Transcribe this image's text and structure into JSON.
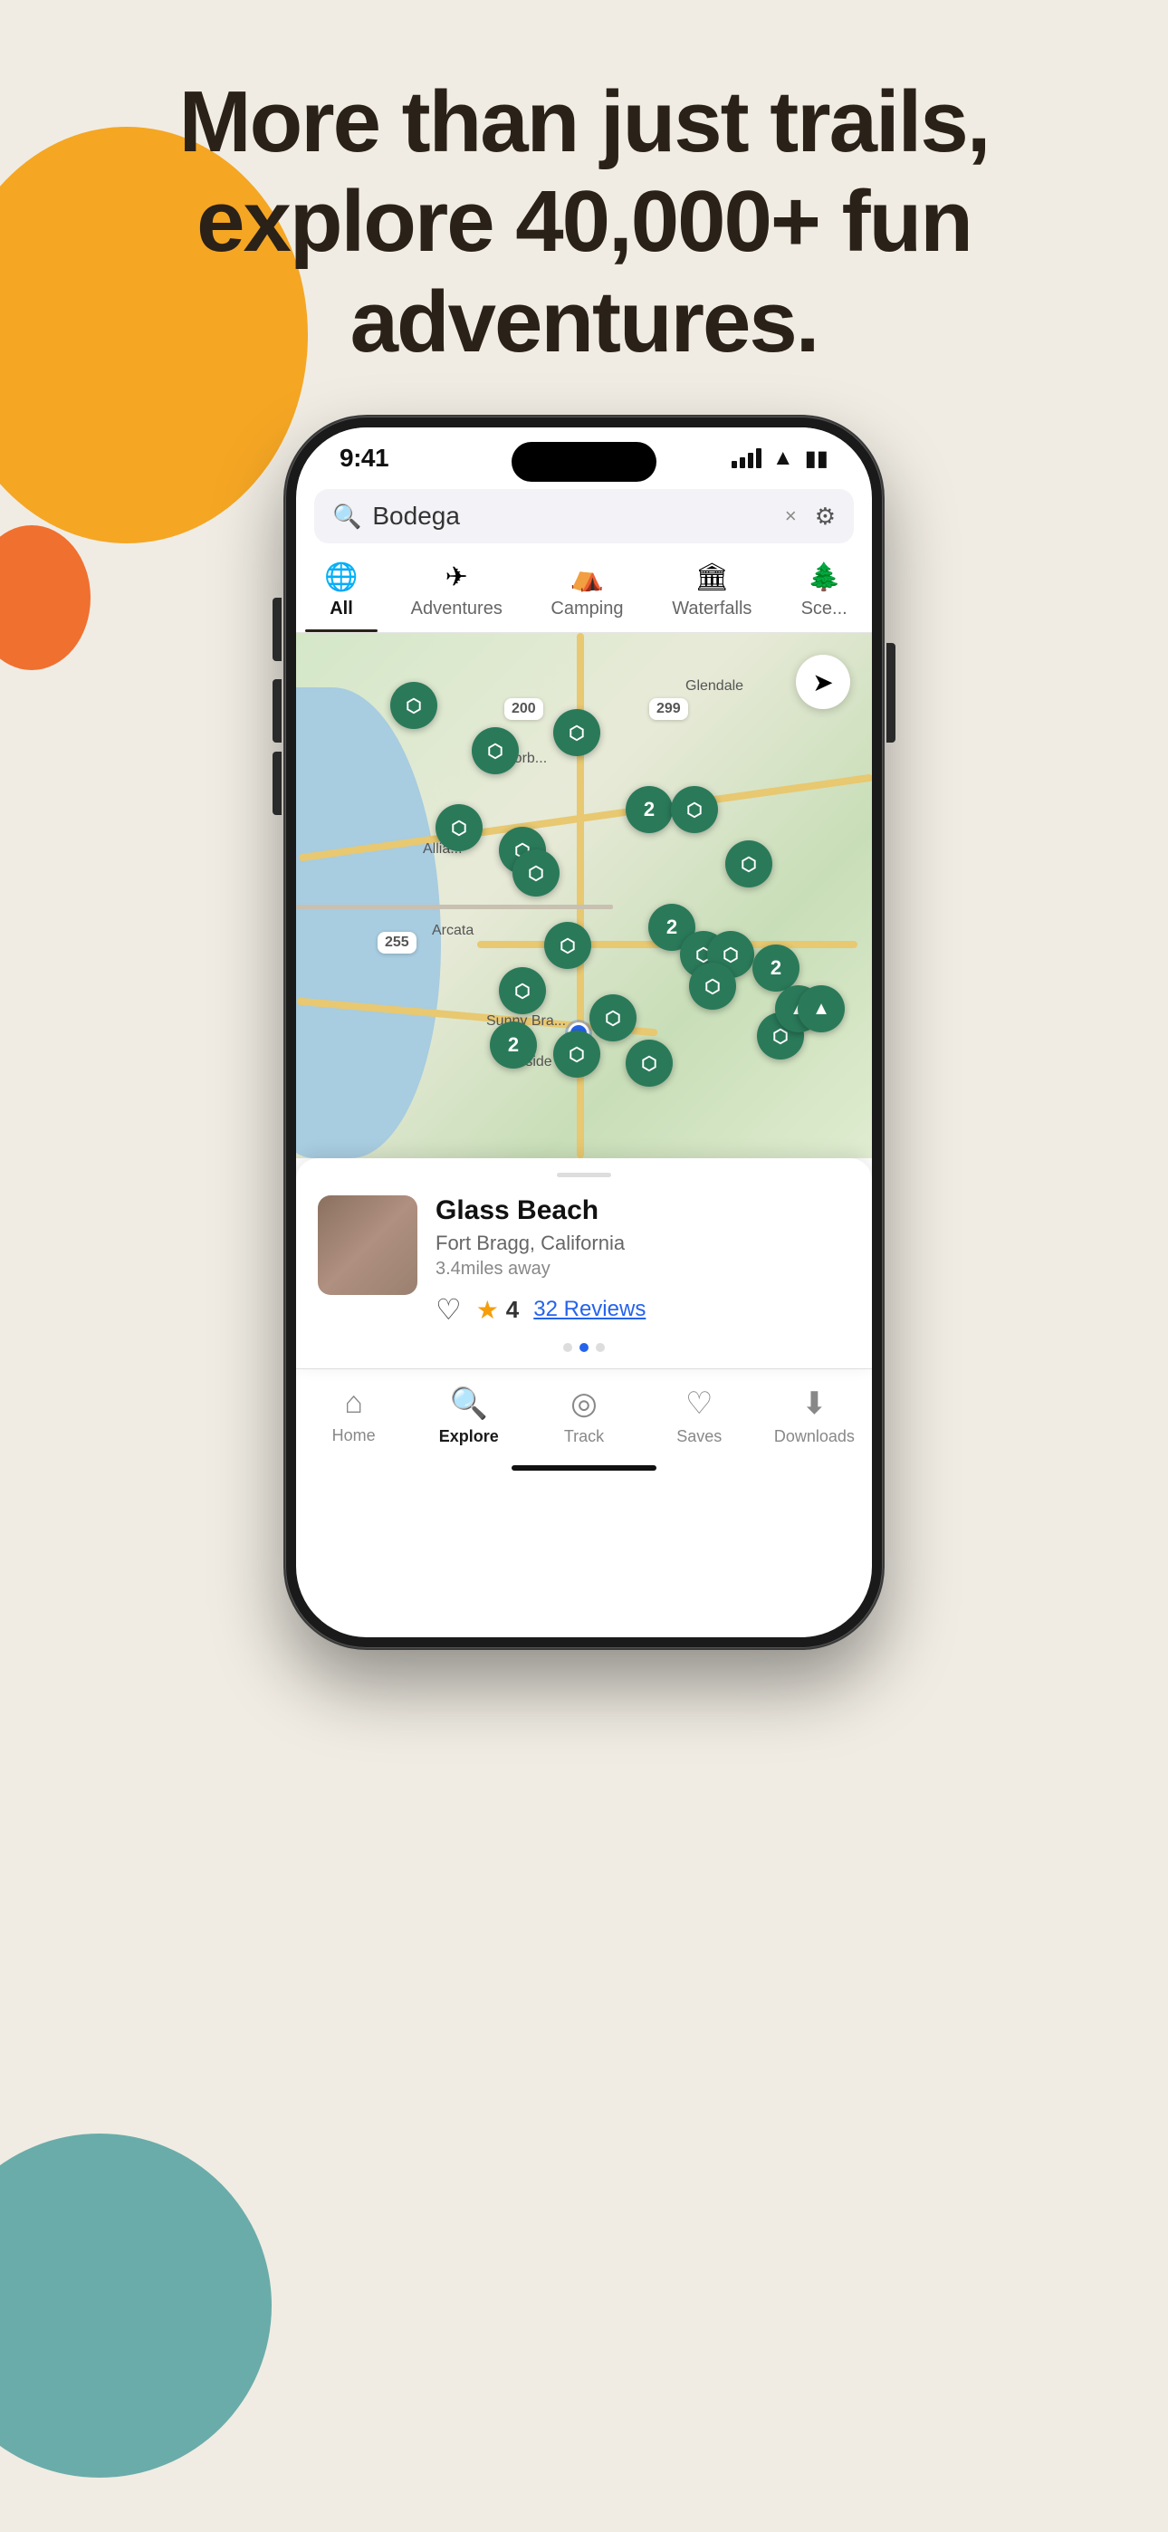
{
  "page": {
    "background_color": "#f0ece3"
  },
  "hero": {
    "title": "More than just trails, explore 40,000+ fun adventures."
  },
  "phone": {
    "status_bar": {
      "time": "9:41",
      "signal": "signal",
      "wifi": "wifi",
      "battery": "battery"
    },
    "search": {
      "placeholder": "Search",
      "value": "Bodega",
      "close_label": "×",
      "filter_label": "filter"
    },
    "category_tabs": [
      {
        "label": "All",
        "icon": "🌐",
        "active": true
      },
      {
        "label": "Adventures",
        "icon": "✈",
        "active": false
      },
      {
        "label": "Camping",
        "icon": "⛺",
        "active": false
      },
      {
        "label": "Waterfalls",
        "icon": "🏛",
        "active": false
      },
      {
        "label": "Scenic",
        "icon": "🌲",
        "active": false
      }
    ],
    "map": {
      "location_name": "Arcata",
      "user_location": "Sunny Brae",
      "route_numbers": [
        "200",
        "299",
        "255"
      ]
    },
    "bottom_card": {
      "title": "Glass Beach",
      "subtitle": "Fort Bragg, California",
      "distance": "3.4miles away",
      "rating": "4",
      "review_count": "32 Reviews",
      "dots": [
        {
          "active": false
        },
        {
          "active": true
        },
        {
          "active": false
        }
      ]
    },
    "bottom_nav": [
      {
        "label": "Home",
        "icon": "home",
        "active": false
      },
      {
        "label": "Explore",
        "icon": "search",
        "active": true
      },
      {
        "label": "Track",
        "icon": "track",
        "active": false
      },
      {
        "label": "Saves",
        "icon": "heart",
        "active": false
      },
      {
        "label": "Downloads",
        "icon": "download",
        "active": false
      }
    ]
  }
}
